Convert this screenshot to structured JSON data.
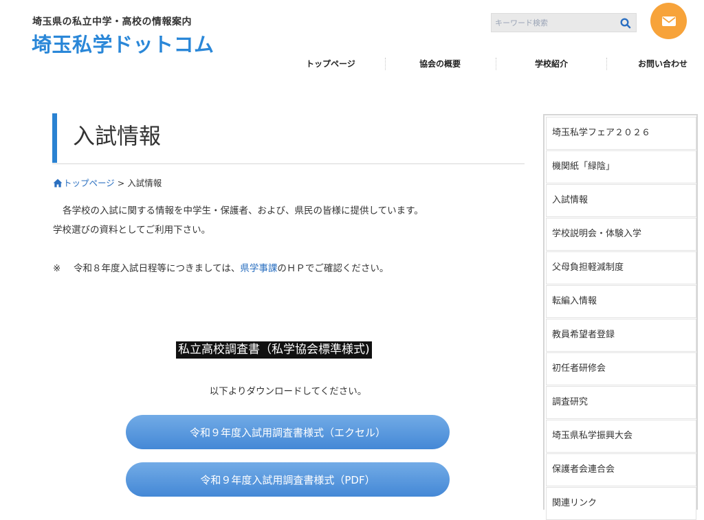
{
  "header": {
    "tagline": "埼玉県の私立中学・高校の情報案内",
    "site_title": "埼玉私学ドットコム",
    "search": {
      "placeholder": "キーワード検索",
      "value": ""
    },
    "accent_color": "#2a87d8",
    "mail_button_color": "#f7a33a"
  },
  "nav": {
    "items": [
      {
        "label": "トップページ"
      },
      {
        "label": "協会の概要"
      },
      {
        "label": "学校紹介"
      },
      {
        "label": "お問い合わせ"
      }
    ]
  },
  "main": {
    "page_title": "入試情報",
    "breadcrumb": {
      "home_label": "トップページ",
      "separator": " > ",
      "current": "入試情報"
    },
    "intro_line1": "各学校の入試に関する情報を中学生・保護者、および、県民の皆様に提供しています。",
    "intro_line2": "学校選びの資料としてご利用下さい。",
    "note": {
      "mark": "※",
      "before": "令和８年度入試日程等につきましては、",
      "link": "県学事課",
      "after": "のＨＰでご確認ください。"
    },
    "section_heading": "私立高校調査書（私学協会標準様式)",
    "download_text": "以下よりダウンロードしてください。",
    "download_buttons": [
      {
        "label": "令和９年度入試用調査書様式（エクセル）"
      },
      {
        "label": "令和９年度入試用調査書様式（PDF）"
      }
    ]
  },
  "sidebar": {
    "items": [
      {
        "label": "埼玉私学フェア２０２６"
      },
      {
        "label": "機関紙「緑陰」"
      },
      {
        "label": "入試情報"
      },
      {
        "label": "学校説明会・体験入学"
      },
      {
        "label": "父母負担軽減制度"
      },
      {
        "label": "転編入情報"
      },
      {
        "label": "教員希望者登録"
      },
      {
        "label": "初任者研修会"
      },
      {
        "label": "調査研究"
      },
      {
        "label": "埼玉県私学振興大会"
      },
      {
        "label": "保護者会連合会"
      },
      {
        "label": "関連リンク"
      }
    ]
  }
}
